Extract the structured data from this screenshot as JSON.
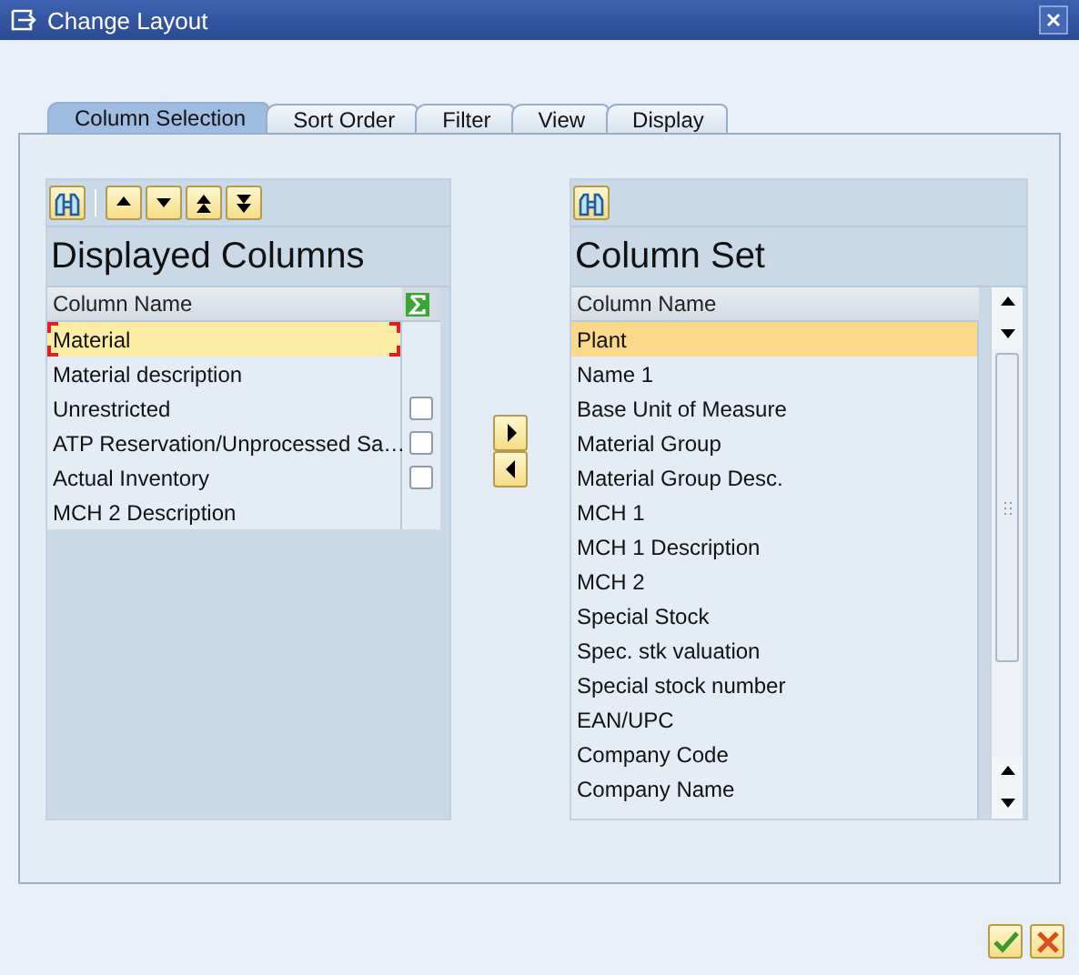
{
  "window": {
    "title": "Change Layout"
  },
  "tabs": [
    {
      "label": "Column Selection",
      "selected": true
    },
    {
      "label": "Sort Order",
      "selected": false
    },
    {
      "label": "Filter",
      "selected": false
    },
    {
      "label": "View",
      "selected": false
    },
    {
      "label": "Display",
      "selected": false
    }
  ],
  "displayed_columns": {
    "title": "Displayed Columns",
    "header": "Column Name",
    "rows": [
      {
        "name": "Material",
        "selected": true
      },
      {
        "name": "Material description",
        "selected": false
      },
      {
        "name": "Unrestricted",
        "selected": false,
        "kind": "summable",
        "checked": false
      },
      {
        "name": "ATP Reservation/Unprocessed Sa…",
        "selected": false,
        "kind": "summable",
        "checked": false
      },
      {
        "name": "Actual Inventory",
        "selected": false,
        "kind": "summable",
        "checked": false
      },
      {
        "name": "MCH 2 Description",
        "selected": false
      }
    ]
  },
  "column_set": {
    "title": "Column Set",
    "header": "Column Name",
    "rows": [
      {
        "name": "Plant",
        "selected": true
      },
      {
        "name": "Name 1",
        "selected": false
      },
      {
        "name": "Base Unit of Measure",
        "selected": false
      },
      {
        "name": "Material Group",
        "selected": false
      },
      {
        "name": "Material Group Desc.",
        "selected": false
      },
      {
        "name": "MCH 1",
        "selected": false
      },
      {
        "name": "MCH 1 Description",
        "selected": false
      },
      {
        "name": "MCH 2",
        "selected": false
      },
      {
        "name": "Special Stock",
        "selected": false
      },
      {
        "name": "Spec. stk valuation",
        "selected": false
      },
      {
        "name": "Special stock number",
        "selected": false
      },
      {
        "name": "EAN/UPC",
        "selected": false
      },
      {
        "name": "Company Code",
        "selected": false
      },
      {
        "name": "Company Name",
        "selected": false
      }
    ]
  }
}
